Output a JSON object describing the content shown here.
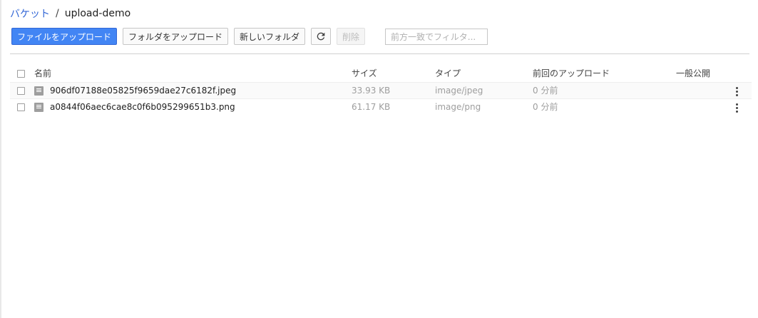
{
  "breadcrumb": {
    "bucket_label": "バケット",
    "separator": "/",
    "current": "upload-demo"
  },
  "toolbar": {
    "upload_files": "ファイルをアップロード",
    "upload_folder": "フォルダをアップロード",
    "new_folder": "新しいフォルダ",
    "refresh_icon": "refresh-icon",
    "delete": "削除",
    "filter_placeholder": "前方一致でフィルタ..."
  },
  "table": {
    "columns": {
      "name": "名前",
      "size": "サイズ",
      "type": "タイプ",
      "last_upload": "前回のアップロード",
      "public": "一般公開"
    },
    "rows": [
      {
        "name": "906df07188e05825f9659dae27c6182f.jpeg",
        "size": "33.93 KB",
        "type": "image/jpeg",
        "last_upload": "0 分前"
      },
      {
        "name": "a0844f06aec6cae8c0f6b095299651b3.png",
        "size": "61.17 KB",
        "type": "image/png",
        "last_upload": "0 分前"
      }
    ]
  },
  "colors": {
    "accent": "#4285f4",
    "link": "#3367d6"
  }
}
